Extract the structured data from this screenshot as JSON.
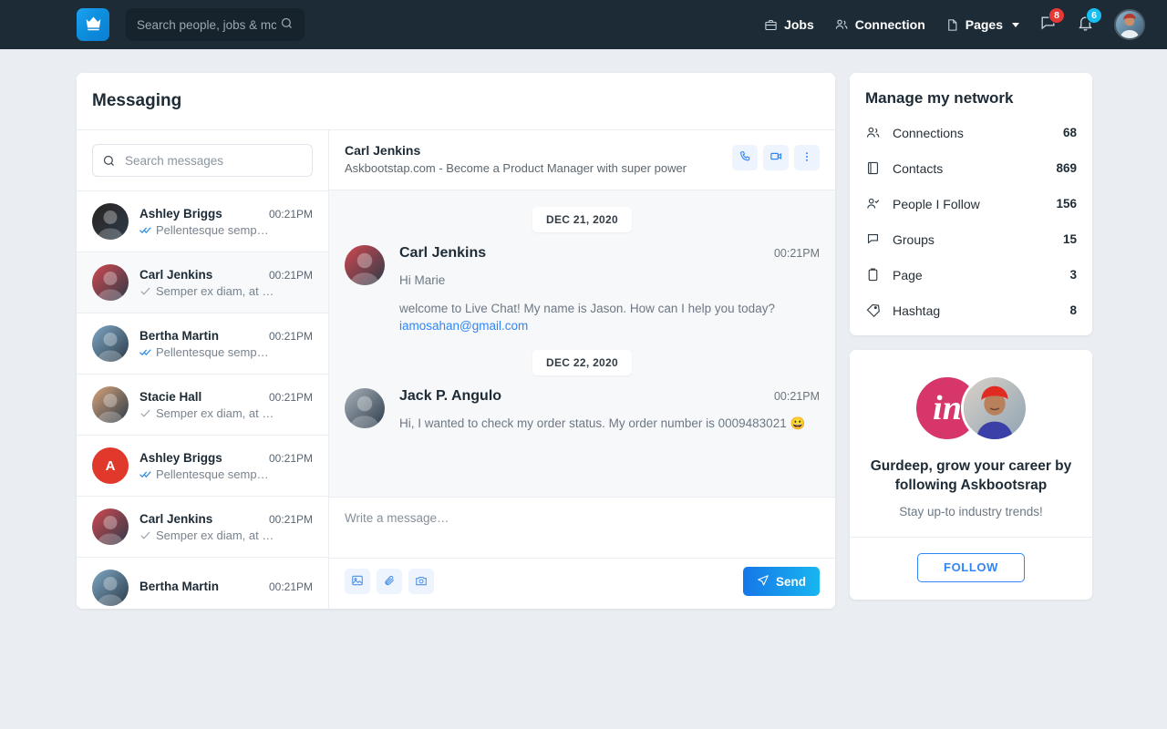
{
  "header": {
    "brand_icon": "crown-icon",
    "search": {
      "value": "",
      "placeholder": "Search people, jobs & mc",
      "icon": "search-icon"
    },
    "nav": [
      {
        "label": "Jobs",
        "icon": "briefcase-icon",
        "caret": false
      },
      {
        "label": "Connection",
        "icon": "people-icon",
        "caret": false
      },
      {
        "label": "Pages",
        "icon": "document-icon",
        "caret": true
      }
    ],
    "messages_icon": "chat-bubble-icon",
    "messages_badge": "8",
    "notifications_icon": "bell-icon",
    "notifications_badge": "6",
    "avatar_icon": "user-avatar",
    "badge_red": "#e53935",
    "badge_cyan": "#16bff0"
  },
  "messaging": {
    "title": "Messaging",
    "search": {
      "value": "",
      "placeholder": "Search messages",
      "icon": "search-icon"
    },
    "threads": [
      {
        "name": "Ashley Briggs",
        "time": "00:21PM",
        "preview": "Pellentesque semp…",
        "check": "double",
        "avatar_type": "photo",
        "avatar_color": "#2a2320",
        "initial": "",
        "active": false
      },
      {
        "name": "Carl Jenkins",
        "time": "00:21PM",
        "preview": "Semper ex diam, at …",
        "check": "single",
        "avatar_type": "photo",
        "avatar_color": "#d2484f",
        "initial": "",
        "active": true
      },
      {
        "name": "Bertha Martin",
        "time": "00:21PM",
        "preview": "Pellentesque semp…",
        "check": "double",
        "avatar_type": "photo",
        "avatar_color": "#7ea7c4",
        "initial": "",
        "active": false
      },
      {
        "name": "Stacie Hall",
        "time": "00:21PM",
        "preview": "Semper ex diam, at …",
        "check": "single",
        "avatar_type": "photo",
        "avatar_color": "#d8a37a",
        "initial": "",
        "active": false
      },
      {
        "name": "Ashley Briggs",
        "time": "00:21PM",
        "preview": "Pellentesque semp…",
        "check": "double",
        "avatar_type": "initial",
        "avatar_color": "#e0392b",
        "initial": "A",
        "active": false
      },
      {
        "name": "Carl Jenkins",
        "time": "00:21PM",
        "preview": "Semper ex diam, at …",
        "check": "single",
        "avatar_type": "photo",
        "avatar_color": "#d2484f",
        "initial": "",
        "active": false
      },
      {
        "name": "Bertha Martin",
        "time": "00:21PM",
        "preview": "",
        "check": "none",
        "avatar_type": "photo",
        "avatar_color": "#7ea7c4",
        "initial": "",
        "active": false
      }
    ]
  },
  "chat": {
    "name": "Carl Jenkins",
    "subtitle": "Askbootstap.com - Become a Product Manager with super power",
    "actions": [
      {
        "icon": "phone-icon",
        "name": "call-button"
      },
      {
        "icon": "video-camera-icon",
        "name": "video-call-button"
      },
      {
        "icon": "more-vertical-icon",
        "name": "chat-options-button"
      }
    ],
    "groups": [
      {
        "date": "DEC 21, 2020",
        "messages": [
          {
            "sender": "Carl Jenkins",
            "time": "00:21PM",
            "avatar_color": "#d2484f",
            "lines": [
              {
                "text": "Hi Marie",
                "link": ""
              },
              {
                "text": "welcome to Live Chat! My name is Jason. How can I help you today?",
                "link": "iamosahan@gmail.com"
              }
            ]
          }
        ]
      },
      {
        "date": "DEC 22, 2020",
        "messages": [
          {
            "sender": "Jack P. Angulo",
            "time": "00:21PM",
            "avatar_color": "#a9b2bb",
            "lines": [
              {
                "text": "Hi, I wanted to check my order status. My order number is 0009483021 😀",
                "link": ""
              }
            ]
          }
        ]
      }
    ],
    "composer": {
      "value": "",
      "placeholder": "Write a message…",
      "tools": [
        {
          "icon": "image-icon",
          "name": "attach-image-button"
        },
        {
          "icon": "paperclip-icon",
          "name": "attach-file-button"
        },
        {
          "icon": "camera-icon",
          "name": "camera-button"
        }
      ],
      "send_label": "Send",
      "send_icon": "send-plane-icon"
    }
  },
  "network": {
    "title": "Manage my network",
    "rows": [
      {
        "label": "Connections",
        "count": "68",
        "icon": "people-icon"
      },
      {
        "label": "Contacts",
        "count": "869",
        "icon": "address-book-icon"
      },
      {
        "label": "People I Follow",
        "count": "156",
        "icon": "person-check-icon"
      },
      {
        "label": "Groups",
        "count": "15",
        "icon": "chat-bubble-icon"
      },
      {
        "label": "Page",
        "count": "3",
        "icon": "clipboard-icon"
      },
      {
        "label": "Hashtag",
        "count": "8",
        "icon": "tag-icon"
      }
    ]
  },
  "promo": {
    "logo_text": "in",
    "logo_color": "#d6366a",
    "title": "Gurdeep, grow your career by following Askbootsrap",
    "subtitle": "Stay up-to industry trends!",
    "button_label": "FOLLOW",
    "accent": "#2f86f6"
  }
}
